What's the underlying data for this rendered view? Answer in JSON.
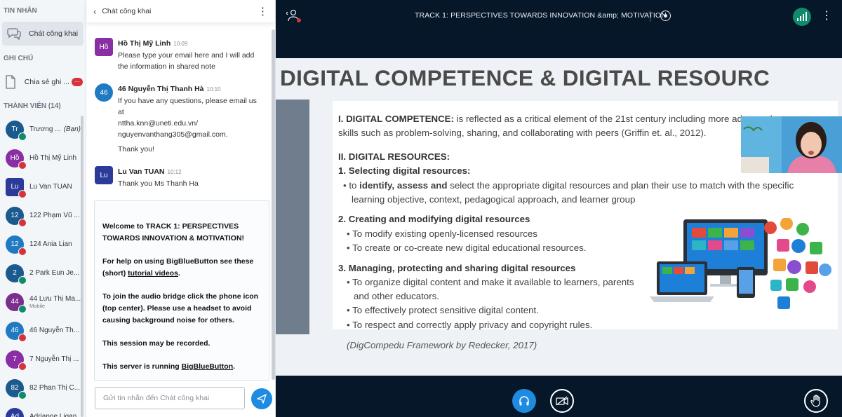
{
  "sidebar": {
    "messages_title": "TIN NHẮN",
    "public_chat": "Chát công khai",
    "notes_title": "GHI CHÚ",
    "shared_notes": "Chia sẻ ghi ...",
    "notes_badge": "···",
    "members_title": "THÀNH VIÊN (14)",
    "members": [
      {
        "initials": "Tr",
        "name": "Trương ...",
        "tag": "(Bạn)",
        "color": "#1b5a8e",
        "status": "green",
        "sub": ""
      },
      {
        "initials": "Hồ",
        "name": "Hồ Thị Mỹ Linh",
        "tag": "",
        "color": "#8a2ea3",
        "status": "red",
        "sub": ""
      },
      {
        "initials": "Lu",
        "name": "Lu Van TUAN",
        "tag": "",
        "color": "#2c3a9a",
        "status": "red",
        "sub": ""
      },
      {
        "initials": "12",
        "name": "122 Phạm Vũ ...",
        "tag": "",
        "color": "#1b5a8e",
        "status": "red",
        "sub": ""
      },
      {
        "initials": "12",
        "name": "124 Ania Lian",
        "tag": "",
        "color": "#1f7ac2",
        "status": "red",
        "sub": ""
      },
      {
        "initials": "2",
        "name": "2 Park Eun Je...",
        "tag": "",
        "color": "#1b5a8e",
        "status": "green",
        "sub": ""
      },
      {
        "initials": "44",
        "name": "44 Lưu Thị Ma...",
        "tag": "",
        "color": "#7b2e8e",
        "status": "green",
        "sub": "Mobile"
      },
      {
        "initials": "46",
        "name": "46 Nguyễn Th...",
        "tag": "",
        "color": "#1f7ac2",
        "status": "red",
        "sub": ""
      },
      {
        "initials": "7",
        "name": "7 Nguyễn Thị ...",
        "tag": "",
        "color": "#8a2ea3",
        "status": "red",
        "sub": ""
      },
      {
        "initials": "82",
        "name": "82 Phan Thị C...",
        "tag": "",
        "color": "#1b5a8e",
        "status": "green",
        "sub": ""
      },
      {
        "initials": "Ad",
        "name": "Adrianne Ligan",
        "tag": "",
        "color": "#2c3a9a",
        "status": "green",
        "sub": ""
      }
    ]
  },
  "chat": {
    "title": "Chát công khai",
    "messages": [
      {
        "initials": "Hồ",
        "color": "#8a2ea3",
        "name": "Hồ Thị Mỹ Linh",
        "time": "10:09",
        "lines": [
          "Please type your email here and I will add",
          "the information in shared note"
        ]
      },
      {
        "initials": "46",
        "color": "#1f7ac2",
        "name": "46 Nguyễn Thị Thanh Hà",
        "time": "10:10",
        "lines": [
          "If you have any questions, please email us at",
          "nttha.knn@uneti.edu.vn/",
          "nguyenvanthang305@gmail.com.",
          "Thank you!"
        ]
      },
      {
        "initials": "Lu",
        "color": "#2c3a9a",
        "name": "Lu Van TUAN",
        "time": "10:12",
        "lines": [
          "Thank you Ms Thanh Ha"
        ]
      }
    ],
    "welcome": {
      "p1_pre": "Welcome to ",
      "p1_bold": "TRACK 1: PERSPECTIVES TOWARDS INNOVATION & MOTIVATION",
      "p1_post": "!",
      "p2_pre": "For help on using BigBlueButton see these (short) ",
      "p2_link": "tutorial videos",
      "p2_post": ".",
      "p3_pre": "To join the audio bridge click the phone icon (top center). ",
      "p3_bold": "Please use a headset to avoid causing background noise for others.",
      "p4": "This session may be recorded.",
      "p5_pre": "This server is running ",
      "p5_link": "BigBlueButton",
      "p5_post": "."
    },
    "input_placeholder": "Gửi tin nhắn đến Chát công khai"
  },
  "topbar": {
    "title": "TRACK 1: PERSPECTIVES TOWARDS INNOVATION &amp; MOTIVATION"
  },
  "slide": {
    "title": "DIGITAL COMPETENCE & DIGITAL RESOURC",
    "s1_head": "I. DIGITAL COMPETENCE:",
    "s1_l1": " is reflected as a critical element of the 21st century including more advanced",
    "s1_l2": "skills such as problem-solving, sharing, and collaborating with peers (Griffin et. al., 2012).",
    "s2_head": "II. DIGITAL RESOURCES:",
    "s2_sub1": "1. Selecting digital resources:",
    "s2_b1_pre": "• to ",
    "s2_b1_bold": "identify, assess and",
    "s2_b1_post": " select the appropriate digital resources and plan their use to match with the specific",
    "s2_b1_l2": "learning objective, context, pedagogical approach, and learner group",
    "s2_sub2": "2. Creating and modifying digital resources",
    "s2_b2": "• To modify  existing openly-licensed resources",
    "s2_b3": "• To create or co-create new digital educational resources.",
    "s2_sub3": "3. Managing, protecting and sharing digital resources",
    "s2_b4": "• To organize digital content and make it available to learners, parents",
    "s2_b4_l2": "and other educators.",
    "s2_b5": "• To effectively protect sensitive digital content.",
    "s2_b6": "• To respect and correctly apply privacy and copyright rules.",
    "citation": "(DigCompedu Framework by Redecker, 2017)"
  }
}
